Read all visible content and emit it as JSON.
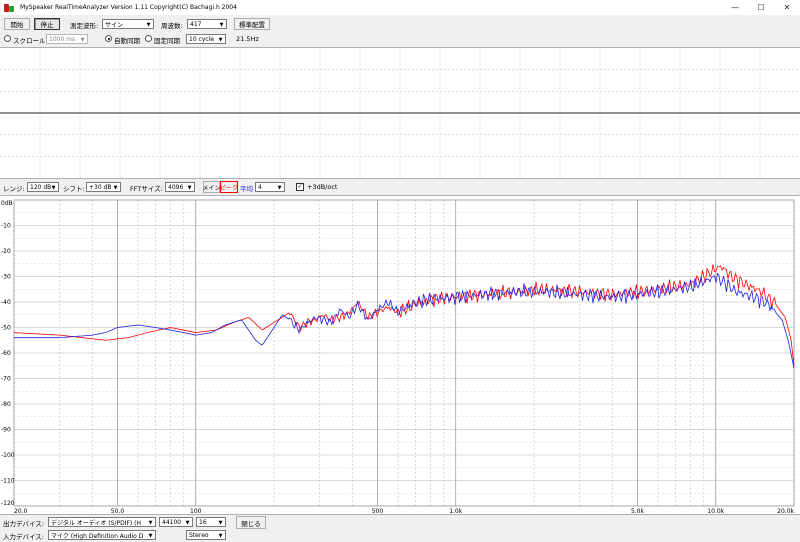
{
  "window": {
    "title": "MySpeaker RealTimeAnalyzer Version 1.11 Copyright(C) Bachagi.h 2004",
    "min_glyph": "—",
    "max_glyph": "☐",
    "close_glyph": "✕"
  },
  "toolbar1": {
    "start_label": "開始",
    "stop_label": "停止",
    "waveform_label": "測定波形:",
    "waveform_value": "サイン",
    "frequency_label": "周波数:",
    "frequency_value": "417",
    "standard_layout_label": "標準配置"
  },
  "toolbar2": {
    "scroll_label": "スクロール",
    "scroll_value": "1000 ms",
    "auto_sync_label": "自動同期",
    "fixed_sync_label": "固定同期",
    "cycle_value": "10 cycle",
    "freq_readout": "21.5Hz"
  },
  "toolbar3": {
    "range_label": "レンジ:",
    "range_value": "120 dB",
    "shift_label": "シフト:",
    "shift_value": "+30 dB",
    "fft_label": "FFTサイズ:",
    "fft_value": "4096",
    "main_label": "メイン",
    "peak_label": "ピーク",
    "average_label": "平均",
    "average_value": "4",
    "octave_label": "+3dB/oct",
    "octave_checked": true
  },
  "bottom": {
    "output_label": "出力デバイス:",
    "output_value": "デジタル オーディオ (S/PDIF) (H",
    "rate_value": "44100",
    "bits_value": "16",
    "close_label": "閉じる",
    "input_label": "入力デバイス:",
    "input_value": "マイク (High Definition Audio D",
    "channel_value": "Stereo"
  },
  "chart_data": {
    "type": "line",
    "x_scale": "log",
    "xlim": [
      20,
      20000
    ],
    "ylim": [
      -120,
      0
    ],
    "grid": true,
    "y_ticks": [
      0,
      -10,
      -20,
      -30,
      -40,
      -50,
      -60,
      -70,
      -80,
      -90,
      -100,
      -110,
      -120
    ],
    "y_tick_labels": [
      "0dB",
      "-10",
      "-20",
      "-30",
      "-40",
      "-50",
      "-60",
      "-70",
      "-80",
      "-90",
      "-100",
      "-110",
      "-120"
    ],
    "x_ticks": [
      20,
      50,
      100,
      500,
      1000,
      5000,
      10000,
      20000
    ],
    "x_tick_labels": [
      "20.0",
      "50.0",
      "100",
      "500",
      "1.0k",
      "5.0k",
      "10.0k",
      "20.0k"
    ],
    "colors": {
      "peak": "#ff0000",
      "average": "#2020e0",
      "grid": "#bfbfbf",
      "grid_major": "#999999"
    },
    "series": [
      {
        "key": "peak",
        "color": "#ff0000",
        "x": [
          20,
          30,
          45,
          55,
          65,
          80,
          100,
          120,
          140,
          160,
          180,
          200,
          215,
          230,
          250,
          270,
          290,
          310,
          330,
          360,
          390,
          420,
          460,
          500,
          550,
          600,
          700,
          800,
          1000,
          1300,
          1700,
          2200,
          3000,
          4000,
          5000,
          6000,
          7000,
          8000,
          9000,
          10000,
          10500,
          11500,
          13000,
          15000,
          17000,
          18500,
          19500,
          20000
        ],
        "y": [
          -52,
          -53,
          -55,
          -54,
          -52,
          -50,
          -52,
          -51,
          -48,
          -46,
          -51,
          -48,
          -46,
          -44,
          -50,
          -48,
          -47,
          -45,
          -47,
          -46,
          -44,
          -40,
          -46,
          -44,
          -42,
          -44,
          -41,
          -39,
          -38,
          -37,
          -36,
          -35,
          -36,
          -37,
          -36,
          -35,
          -34,
          -33,
          -30,
          -27,
          -26,
          -30,
          -33,
          -36,
          -41,
          -46,
          -55,
          -65
        ]
      },
      {
        "key": "average",
        "color": "#2020e0",
        "x": [
          20,
          30,
          40,
          45,
          50,
          60,
          70,
          80,
          90,
          100,
          115,
          130,
          150,
          170,
          180,
          200,
          215,
          230,
          250,
          270,
          290,
          310,
          330,
          360,
          390,
          420,
          460,
          500,
          550,
          600,
          700,
          800,
          1000,
          1300,
          1700,
          2200,
          3000,
          4000,
          5000,
          6000,
          7000,
          8000,
          9000,
          10000,
          11000,
          12000,
          14000,
          16000,
          18000,
          19000,
          20000
        ],
        "y": [
          -54,
          -54,
          -53,
          -52,
          -50,
          -49,
          -50,
          -51,
          -52,
          -53,
          -52,
          -49,
          -47,
          -55,
          -57,
          -50,
          -45,
          -47,
          -51,
          -48,
          -46,
          -47,
          -48,
          -43,
          -46,
          -41,
          -47,
          -43,
          -40,
          -44,
          -40,
          -39,
          -38,
          -37,
          -36,
          -36,
          -37,
          -38,
          -37,
          -36,
          -35,
          -34,
          -32,
          -30,
          -33,
          -36,
          -38,
          -41,
          -47,
          -55,
          -66
        ]
      }
    ]
  }
}
